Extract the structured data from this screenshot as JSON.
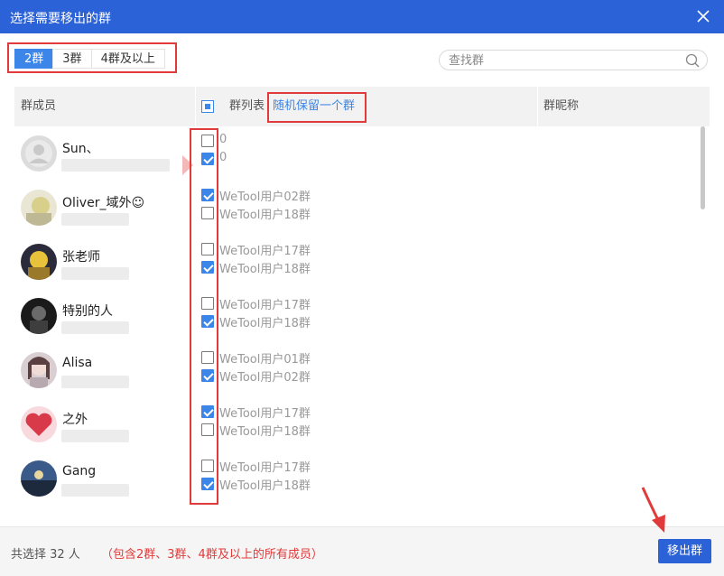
{
  "window": {
    "title": "选择需要移出的群"
  },
  "tabs": [
    {
      "label": "2群",
      "active": true
    },
    {
      "label": "3群",
      "active": false
    },
    {
      "label": "4群及以上",
      "active": false
    }
  ],
  "search": {
    "placeholder": "查找群"
  },
  "table": {
    "col_members": "群成员",
    "col_groups": "群列表",
    "random_keep": "随机保留一个群",
    "col_nickname": "群昵称"
  },
  "rows": [
    {
      "name": "Sun、",
      "groups": [
        {
          "label": "0",
          "checked": false
        },
        {
          "label": "0",
          "checked": true
        }
      ]
    },
    {
      "name": "Oliver_域外☺",
      "groups": [
        {
          "label": "WeTool用户02群",
          "checked": true
        },
        {
          "label": "WeTool用户18群",
          "checked": false
        }
      ]
    },
    {
      "name": "张老师",
      "groups": [
        {
          "label": "WeTool用户17群",
          "checked": false
        },
        {
          "label": "WeTool用户18群",
          "checked": true
        }
      ]
    },
    {
      "name": "特别的人",
      "groups": [
        {
          "label": "WeTool用户17群",
          "checked": false
        },
        {
          "label": "WeTool用户18群",
          "checked": true
        }
      ]
    },
    {
      "name": "Alisa",
      "groups": [
        {
          "label": "WeTool用户01群",
          "checked": false
        },
        {
          "label": "WeTool用户02群",
          "checked": true
        }
      ]
    },
    {
      "name": "之外",
      "groups": [
        {
          "label": "WeTool用户17群",
          "checked": true
        },
        {
          "label": "WeTool用户18群",
          "checked": false
        }
      ]
    },
    {
      "name": "Gang",
      "groups": [
        {
          "label": "WeTool用户17群",
          "checked": false
        },
        {
          "label": "WeTool用户18群",
          "checked": true
        }
      ]
    }
  ],
  "footer": {
    "count_text": "共选择 32 人",
    "note": "（包含2群、3群、4群及以上的所有成员）",
    "move_button": "移出群"
  },
  "colors": {
    "accent": "#2c62d8",
    "checkbox": "#3b86e8",
    "highlight": "#e03a3a"
  }
}
